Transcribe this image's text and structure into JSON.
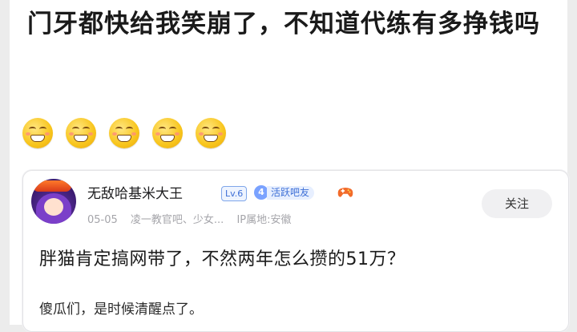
{
  "post": {
    "title": "门牙都快给我笑崩了，不知道代练有多挣钱吗"
  },
  "emojis": [
    "laughing-face",
    "laughing-face",
    "laughing-face",
    "laughing-face",
    "laughing-face"
  ],
  "reply": {
    "username": "无敌哈基米大王",
    "level": "Lv.6",
    "active_badge_number": "4",
    "active_badge_text": "活跃吧友",
    "date": "05-05",
    "communities": "凌一教官吧、少女...",
    "ip_location": "IP属地:安徽",
    "follow_label": "关注",
    "content": "胖猫肯定搞网带了，不然两年怎么攒的51万？",
    "content_2": "傻瓜们，是时候清醒点了。"
  },
  "colors": {
    "accent_blue": "#3d6fd6",
    "emoji_yellow": "#f8c51c"
  }
}
